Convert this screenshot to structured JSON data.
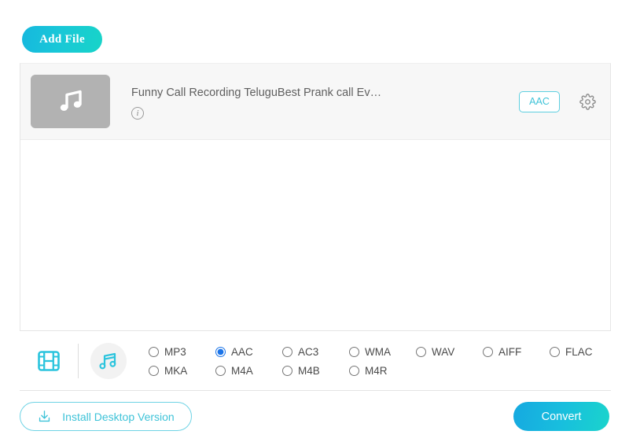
{
  "toolbar": {
    "add_file_label": "Add File"
  },
  "file_list": {
    "rows": [
      {
        "name": "Funny Call Recording TeluguBest Prank call Ev…",
        "thumb_icon": "music-note-icon",
        "info_icon": "info-icon",
        "info_glyph": "i",
        "format": "AAC",
        "settings_icon": "gear-icon"
      }
    ]
  },
  "format_selector": {
    "tabs": [
      {
        "id": "video",
        "icon": "film-strip-icon",
        "selected": false
      },
      {
        "id": "audio",
        "icon": "music-note-icon",
        "selected": true
      }
    ],
    "selected_format": "AAC",
    "rows": [
      [
        "MP3",
        "AAC",
        "AC3",
        "WMA",
        "WAV",
        "AIFF",
        "FLAC"
      ],
      [
        "MKA",
        "M4A",
        "M4B",
        "M4R"
      ]
    ]
  },
  "footer": {
    "install_label": "Install Desktop Version",
    "install_icon": "download-icon",
    "convert_label": "Convert"
  },
  "colors": {
    "accent_cyan": "#3ec3d8",
    "gradient_start": "#16b8de",
    "gradient_end": "#18d4c8",
    "radio_selected": "#1a73e8",
    "row_background": "#f7f7f7",
    "thumb_background": "#b2b2b2"
  }
}
